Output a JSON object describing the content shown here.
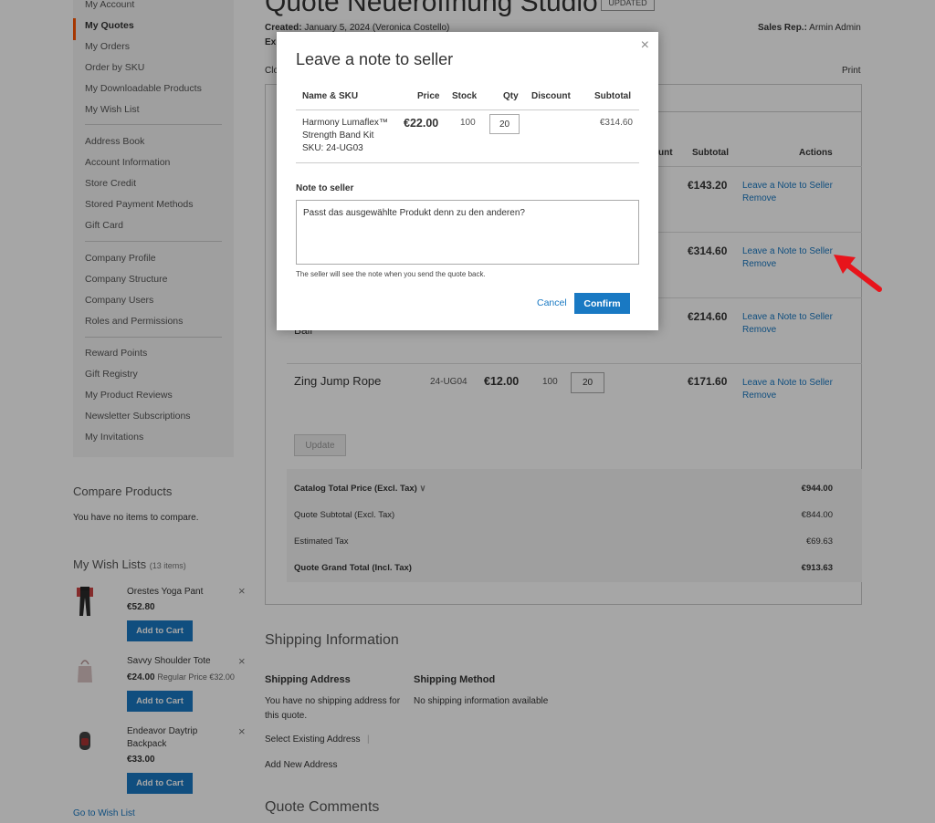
{
  "sidebar": {
    "items": [
      {
        "label": "My Account",
        "active": false
      },
      {
        "label": "My Quotes",
        "active": true
      },
      {
        "label": "My Orders",
        "active": false
      },
      {
        "label": "Order by SKU",
        "active": false
      },
      {
        "label": "My Downloadable Products",
        "active": false
      },
      {
        "label": "My Wish List",
        "active": false
      },
      {
        "label": "Address Book",
        "active": false
      },
      {
        "label": "Account Information",
        "active": false
      },
      {
        "label": "Store Credit",
        "active": false
      },
      {
        "label": "Stored Payment Methods",
        "active": false
      },
      {
        "label": "Gift Card",
        "active": false
      },
      {
        "label": "Company Profile",
        "active": false
      },
      {
        "label": "Company Structure",
        "active": false
      },
      {
        "label": "Company Users",
        "active": false
      },
      {
        "label": "Roles and Permissions",
        "active": false
      },
      {
        "label": "Reward Points",
        "active": false
      },
      {
        "label": "Gift Registry",
        "active": false
      },
      {
        "label": "My Product Reviews",
        "active": false
      },
      {
        "label": "Newsletter Subscriptions",
        "active": false
      },
      {
        "label": "My Invitations",
        "active": false
      }
    ]
  },
  "compare": {
    "title": "Compare Products",
    "empty": "You have no items to compare."
  },
  "wishlists": {
    "title": "My Wish Lists",
    "count": "(13 items)",
    "add_to_cart": "Add to Cart",
    "remove": "×",
    "go_to": "Go to Wish List",
    "items": [
      {
        "name": "Orestes Yoga Pant",
        "price": "€52.80",
        "regular": ""
      },
      {
        "name": "Savvy Shoulder Tote",
        "price": "€24.00",
        "regular": "Regular Price €32.00"
      },
      {
        "name": "Endeavor Daytrip Backpack",
        "price": "€33.00",
        "regular": ""
      }
    ]
  },
  "quote": {
    "title": "Quote Neueröffnung Studio",
    "status": "UPDATED",
    "created_label": "Created:",
    "created_value": "January 5, 2024 (Veronica Costello)",
    "expires_label": "Exp",
    "close_link": "Clo",
    "sales_rep_label": "Sales Rep.:",
    "sales_rep_value": "Armin Admin",
    "print": "Print"
  },
  "items_table": {
    "headers": {
      "discount_partial": "unt",
      "subtotal": "Subtotal",
      "actions": "Actions"
    },
    "rows": [
      {
        "subtotal": "€143.20"
      },
      {
        "subtotal": "€314.60"
      },
      {
        "subtotal": "€214.60",
        "partial_name": "Ball"
      },
      {
        "name": "Zing Jump Rope",
        "sku": "24-UG04",
        "price": "€12.00",
        "stock": "100",
        "qty": "20",
        "subtotal": "€171.60"
      }
    ],
    "leave_note": "Leave a Note to Seller",
    "remove": "Remove",
    "update": "Update"
  },
  "totals": [
    {
      "label": "Catalog Total Price (Excl. Tax)",
      "value": "€944.00",
      "bold": true
    },
    {
      "label": "Quote Subtotal (Excl. Tax)",
      "value": "€844.00",
      "bold": false
    },
    {
      "label": "Estimated Tax",
      "value": "€69.63",
      "bold": false
    },
    {
      "label": "Quote Grand Total (Incl. Tax)",
      "value": "€913.63",
      "bold": true
    }
  ],
  "shipping": {
    "title": "Shipping Information",
    "address_title": "Shipping Address",
    "address_text": "You have no shipping address for this quote.",
    "method_title": "Shipping Method",
    "method_text": "No shipping information available",
    "select_existing": "Select Existing Address",
    "add_new": "Add New Address"
  },
  "comments": {
    "title": "Quote Comments"
  },
  "modal": {
    "title": "Leave a note to seller",
    "close": "×",
    "headers": {
      "name": "Name & SKU",
      "price": "Price",
      "stock": "Stock",
      "qty": "Qty",
      "discount": "Discount",
      "subtotal": "Subtotal"
    },
    "product": {
      "name": "Harmony Lumaflex™ Strength Band Kit",
      "sku": "SKU: 24-UG03",
      "price": "€22.00",
      "stock": "100",
      "qty": "20",
      "subtotal": "€314.60"
    },
    "note_label": "Note to seller",
    "note_value": "Passt das ausgewählte Produkt denn zu den anderen?",
    "hint": "The seller will see the note when you send the quote back.",
    "cancel": "Cancel",
    "confirm": "Confirm"
  },
  "colors": {
    "accent": "#1979c3",
    "active_nav": "#ff5501",
    "arrow": "#e8141b"
  }
}
